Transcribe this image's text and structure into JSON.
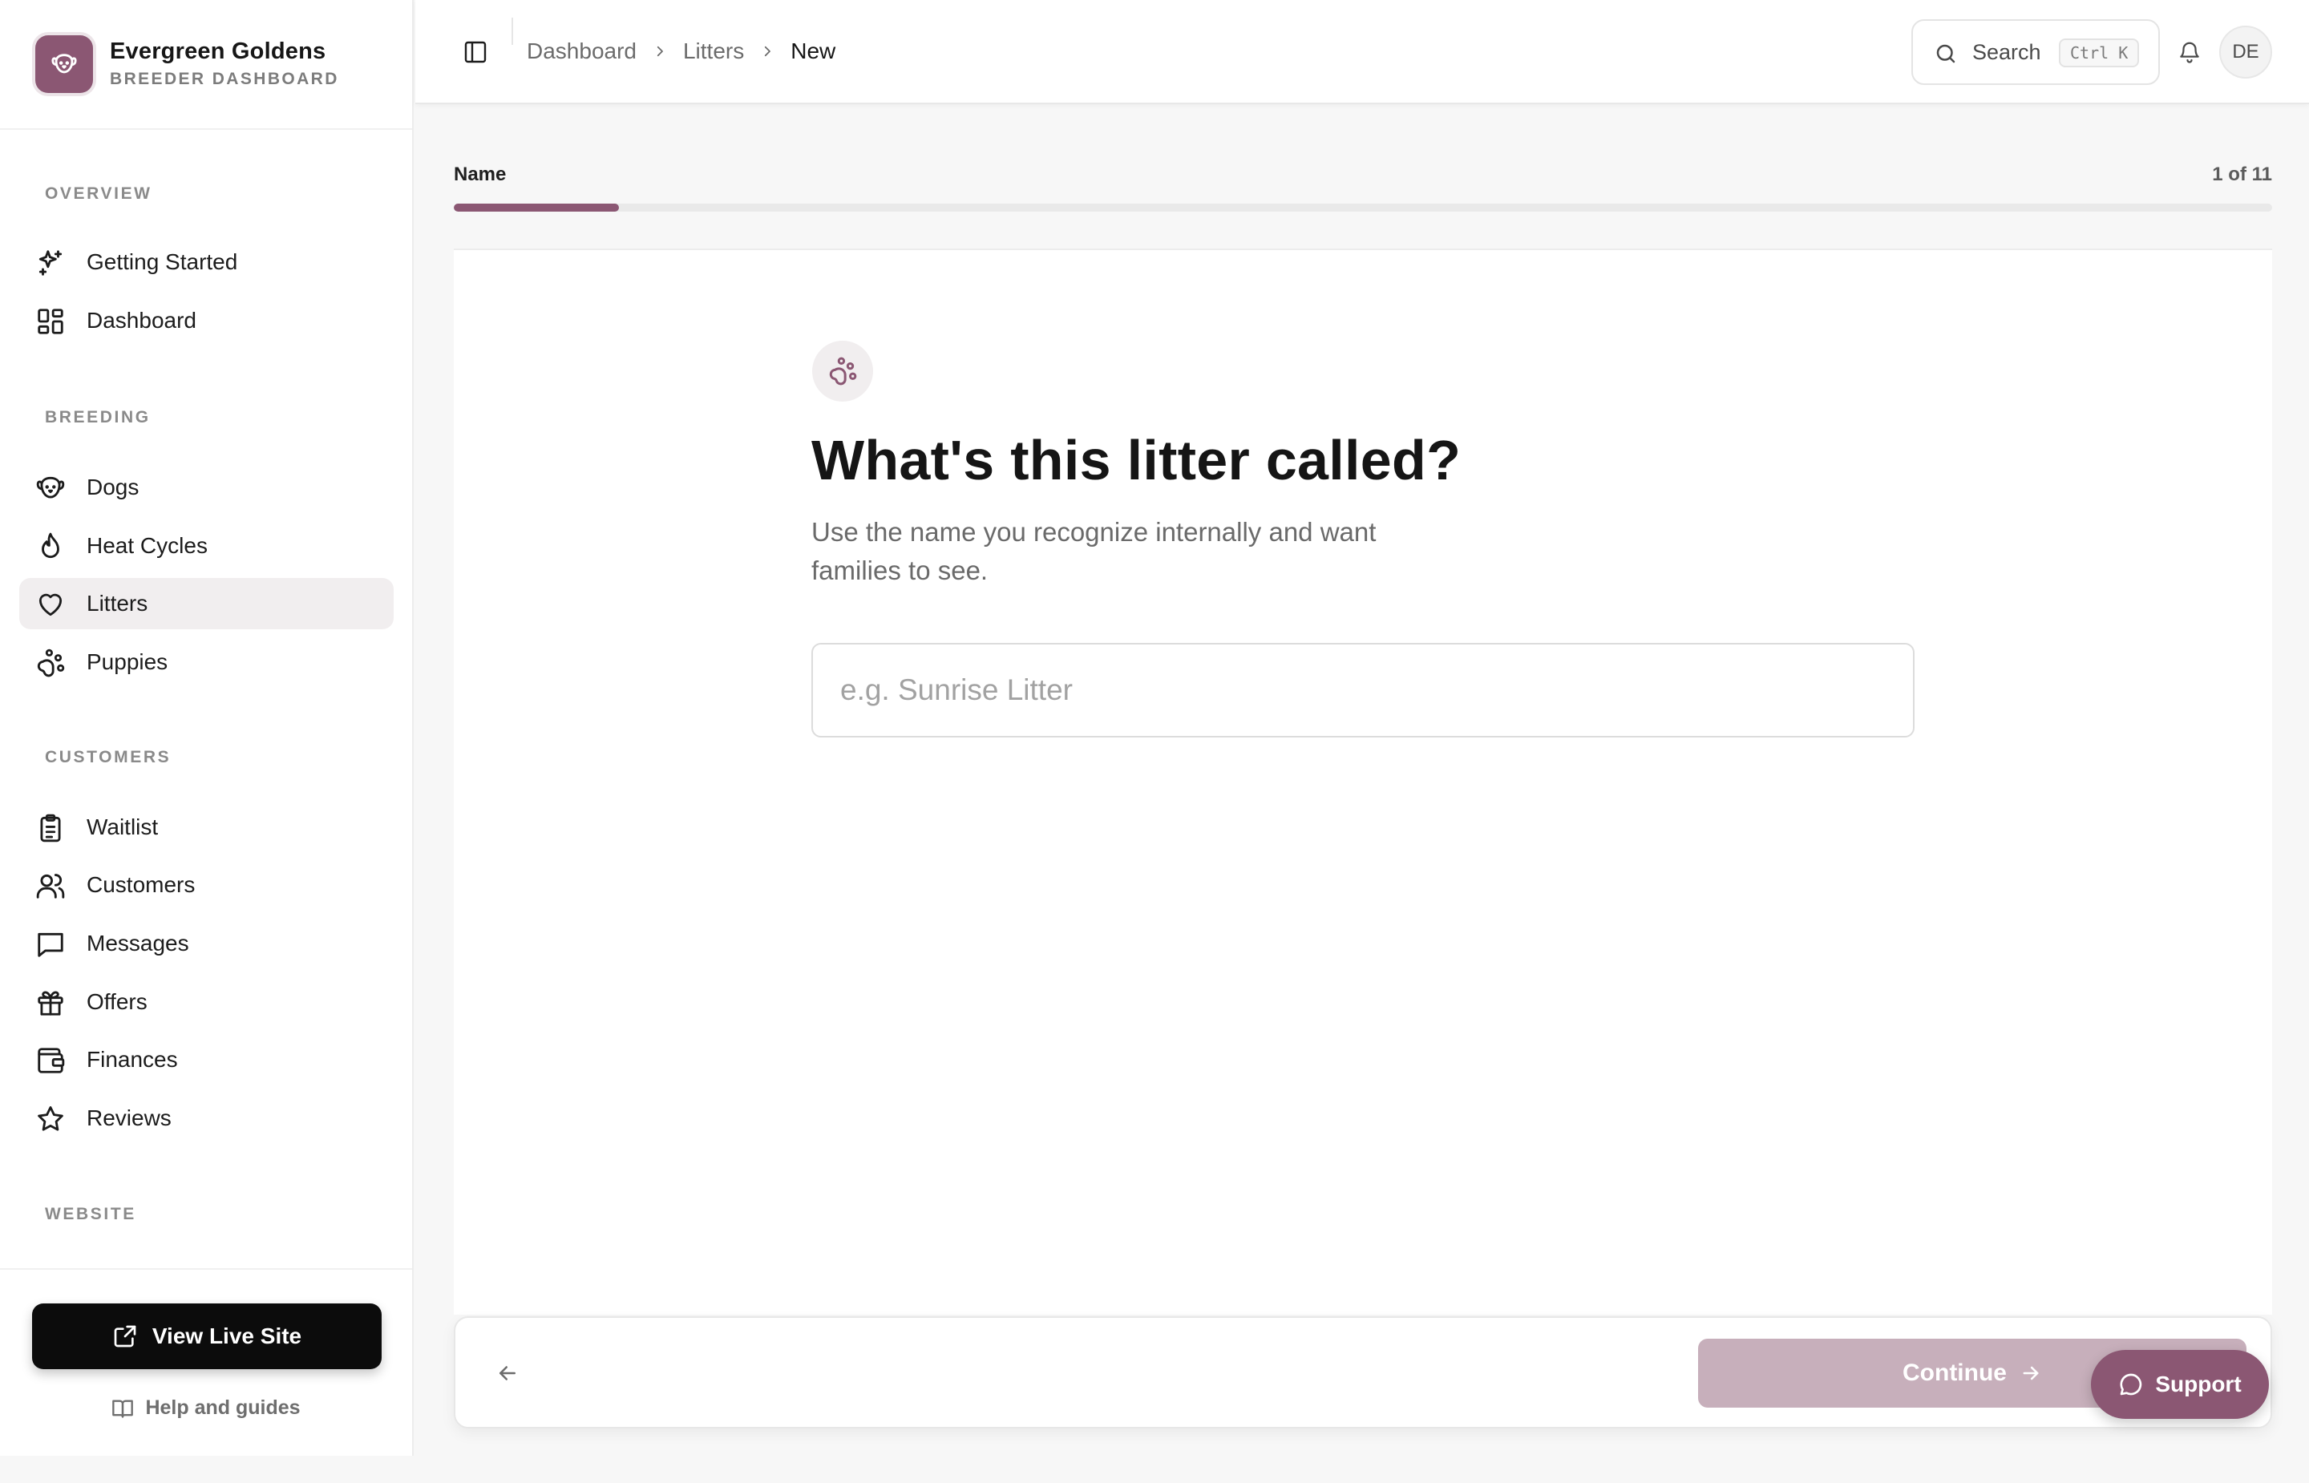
{
  "brand": {
    "name": "Evergreen Goldens",
    "subtitle": "BREEDER DASHBOARD",
    "logo_icon": "dog-face-icon"
  },
  "sidebar": {
    "sections": [
      {
        "label": "OVERVIEW",
        "items": [
          {
            "label": "Getting Started",
            "icon": "sparkles-icon",
            "active": false
          },
          {
            "label": "Dashboard",
            "icon": "dashboard-grid-icon",
            "active": false
          }
        ]
      },
      {
        "label": "BREEDING",
        "items": [
          {
            "label": "Dogs",
            "icon": "dog-face-icon",
            "active": false
          },
          {
            "label": "Heat Cycles",
            "icon": "flame-icon",
            "active": false
          },
          {
            "label": "Litters",
            "icon": "heart-icon",
            "active": true
          },
          {
            "label": "Puppies",
            "icon": "paw-print-icon",
            "active": false
          }
        ]
      },
      {
        "label": "CUSTOMERS",
        "items": [
          {
            "label": "Waitlist",
            "icon": "clipboard-list-icon",
            "active": false
          },
          {
            "label": "Customers",
            "icon": "users-icon",
            "active": false
          },
          {
            "label": "Messages",
            "icon": "message-square-icon",
            "active": false
          },
          {
            "label": "Offers",
            "icon": "gift-icon",
            "active": false
          },
          {
            "label": "Finances",
            "icon": "wallet-icon",
            "active": false
          },
          {
            "label": "Reviews",
            "icon": "star-icon",
            "active": false
          }
        ]
      },
      {
        "label": "WEBSITE",
        "items": []
      }
    ],
    "footer": {
      "live_site_label": "View Live Site",
      "help_label": "Help and guides"
    }
  },
  "topbar": {
    "breadcrumbs": [
      "Dashboard",
      "Litters",
      "New"
    ],
    "search_label": "Search",
    "search_shortcut": "Ctrl K",
    "avatar_initials": "DE"
  },
  "wizard": {
    "step_label": "Name",
    "step_count": "1 of 11",
    "progress_fraction": 0.0909,
    "question_title": "What's this litter called?",
    "question_subtitle": "Use the name you recognize internally and want families to see.",
    "input_value": "",
    "input_placeholder": "e.g. Sunrise Litter",
    "continue_label": "Continue"
  },
  "support": {
    "label": "Support"
  },
  "colors": {
    "accent": "#8b5773",
    "accent_soft": "#f1eeef",
    "continue_disabled": "#c7afbb"
  }
}
